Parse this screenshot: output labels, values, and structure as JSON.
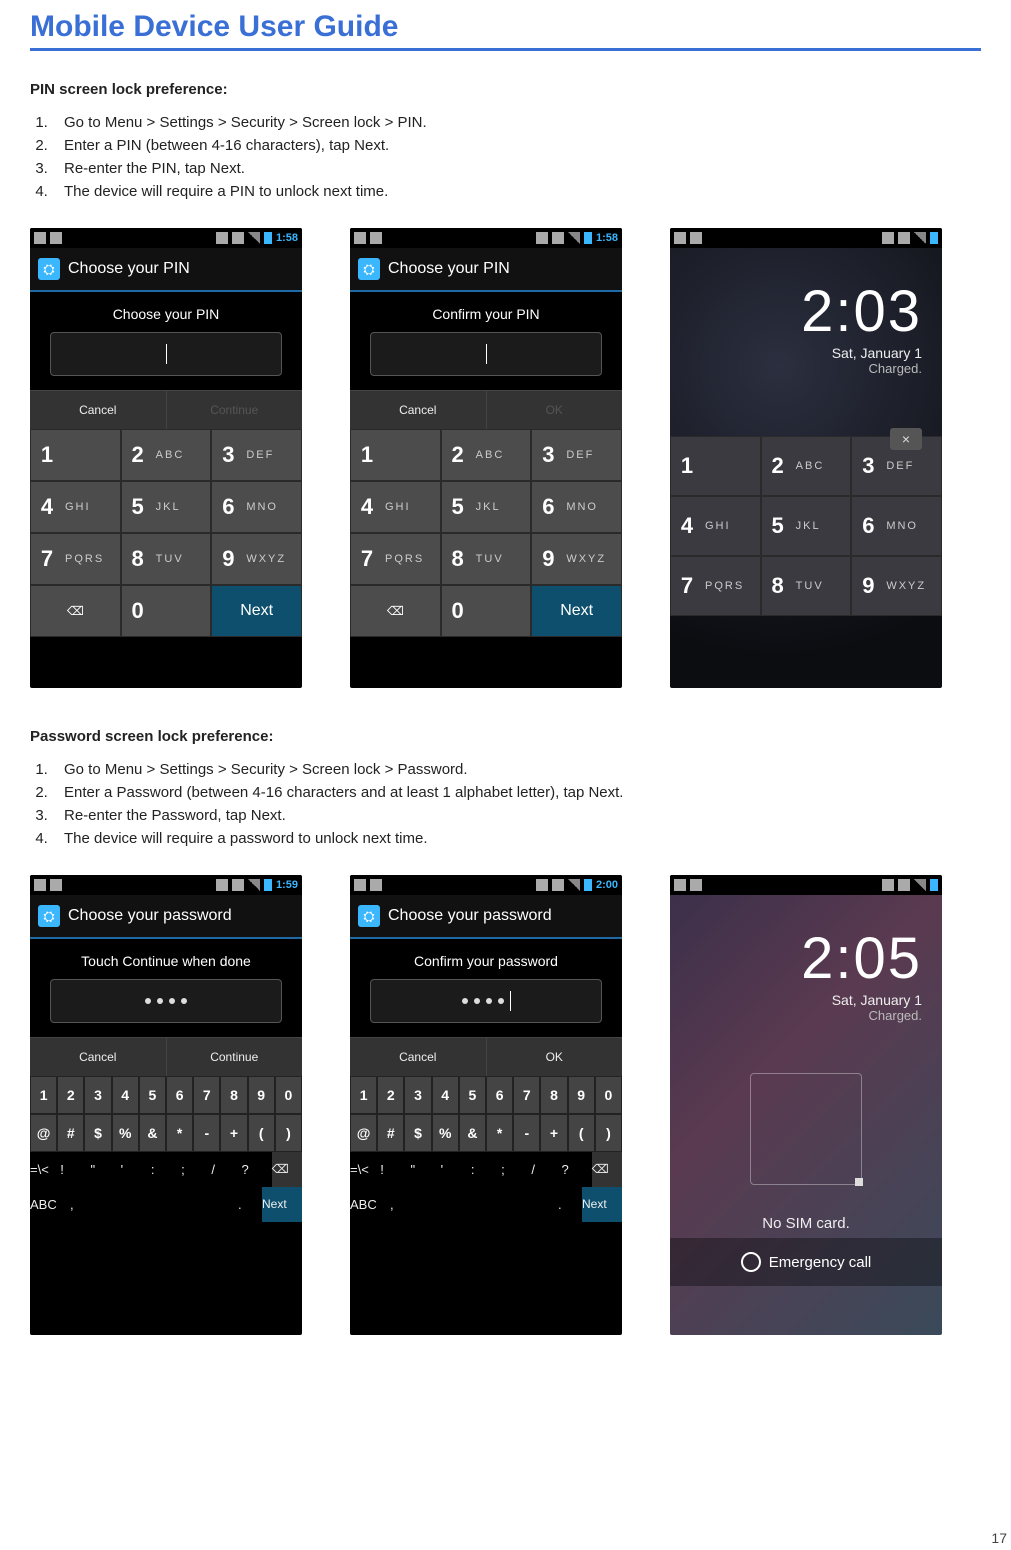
{
  "doc_title": "Mobile Device User Guide",
  "page_number": "17",
  "pin": {
    "heading": "PIN screen lock preference:",
    "steps": [
      "Go to Menu > Settings > Security > Screen lock > PIN.",
      "Enter a PIN (between 4-16 characters), tap Next.",
      "Re-enter the PIN, tap Next.",
      "The device will require a PIN to unlock next time."
    ],
    "shot1": {
      "clock": "1:58",
      "header": "Choose your PIN",
      "instr": "Choose your PIN",
      "cancel": "Cancel",
      "continue": "Continue"
    },
    "shot2": {
      "clock": "1:58",
      "header": "Choose your PIN",
      "instr": "Confirm your PIN",
      "cancel": "Cancel",
      "ok": "OK"
    },
    "shot3": {
      "clock": "2:03",
      "date": "Sat, January 1",
      "status": "Charged."
    },
    "keys": [
      {
        "n": "1",
        "l": ""
      },
      {
        "n": "2",
        "l": "ABC"
      },
      {
        "n": "3",
        "l": "DEF"
      },
      {
        "n": "4",
        "l": "GHI"
      },
      {
        "n": "5",
        "l": "JKL"
      },
      {
        "n": "6",
        "l": "MNO"
      },
      {
        "n": "7",
        "l": "PQRS"
      },
      {
        "n": "8",
        "l": "TUV"
      },
      {
        "n": "9",
        "l": "WXYZ"
      }
    ],
    "zero": "0",
    "next": "Next"
  },
  "pw": {
    "heading": "Password screen lock preference:",
    "steps": [
      "Go to Menu > Settings > Security > Screen lock > Password.",
      "Enter a Password (between 4-16 characters and at least 1 alphabet letter), tap Next.",
      "Re-enter the Password, tap Next.",
      "The device will require a password to unlock next time."
    ],
    "shot1": {
      "clock": "1:59",
      "header": "Choose your password",
      "instr": "Touch Continue when done",
      "cancel": "Cancel",
      "continue": "Continue"
    },
    "shot2": {
      "clock": "2:00",
      "header": "Choose your password",
      "instr": "Confirm your password",
      "cancel": "Cancel",
      "ok": "OK"
    },
    "shot3": {
      "clock": "2:05",
      "date": "Sat, January 1",
      "status": "Charged.",
      "nosim": "No SIM card.",
      "emergency": "Emergency call"
    },
    "kb_r1": [
      "1",
      "2",
      "3",
      "4",
      "5",
      "6",
      "7",
      "8",
      "9",
      "0"
    ],
    "kb_r2": [
      "@",
      "#",
      "$",
      "%",
      "&",
      "*",
      "-",
      "+",
      "(",
      ")"
    ],
    "kb_r3": [
      "=\\<",
      "!",
      "\"",
      "'",
      ":",
      ";",
      "/",
      "?",
      "⌫"
    ],
    "kb_r4": {
      "abc": "ABC",
      "comma": ",",
      "dot": ".",
      "next": "Next"
    }
  }
}
